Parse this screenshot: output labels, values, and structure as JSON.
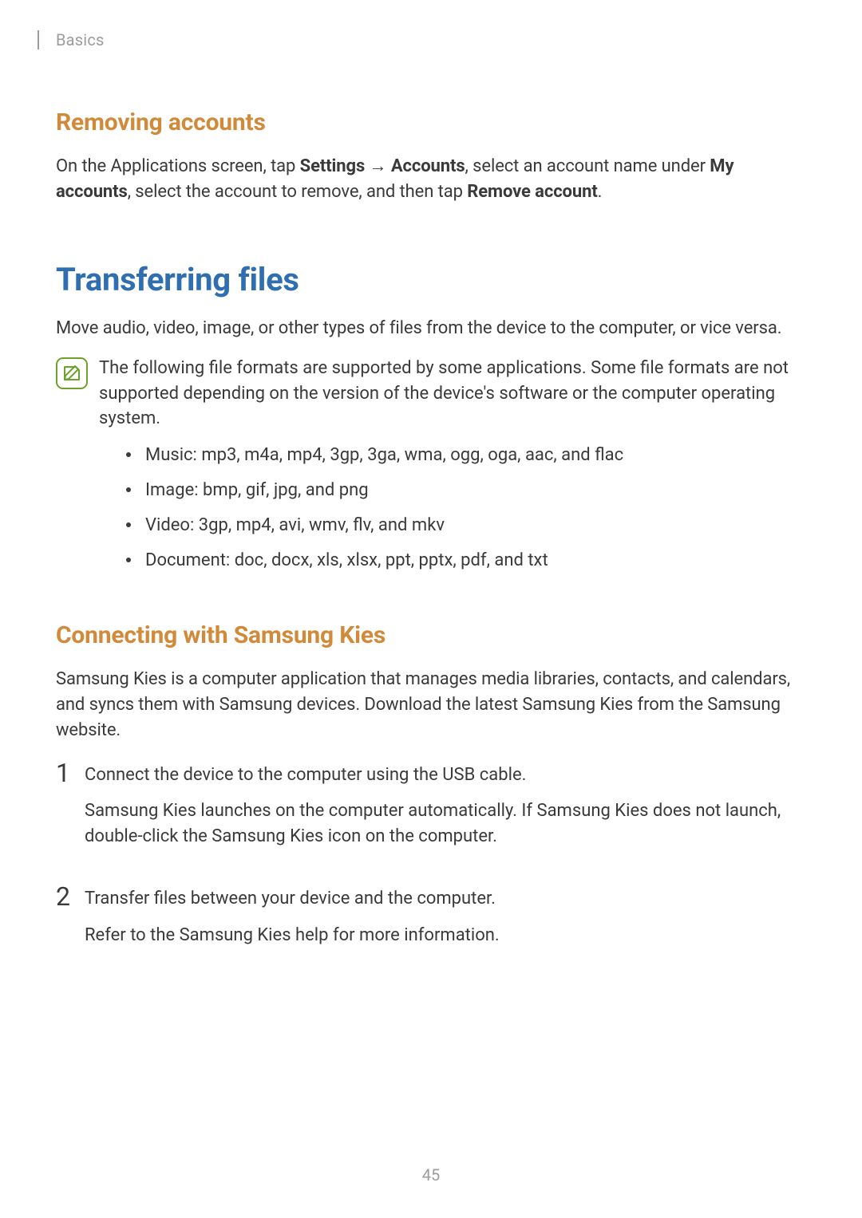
{
  "breadcrumb": "Basics",
  "section1": {
    "heading": "Removing accounts",
    "p_pre": "On the Applications screen, tap ",
    "settings": "Settings",
    "arrow": " → ",
    "accounts": "Accounts",
    "p_mid": ", select an account name under ",
    "myaccounts": "My accounts",
    "p_mid2": ", select the account to remove, and then tap ",
    "remove": "Remove account",
    "p_end": "."
  },
  "section2": {
    "heading": "Transferring files",
    "intro": "Move audio, video, image, or other types of files from the device to the computer, or vice versa.",
    "note": "The following file formats are supported by some applications. Some file formats are not supported depending on the version of the device's software or the computer operating system.",
    "bullets": [
      "Music: mp3, m4a, mp4, 3gp, 3ga, wma, ogg, oga, aac, and flac",
      "Image: bmp, gif, jpg, and png",
      "Video: 3gp, mp4, avi, wmv, flv, and mkv",
      "Document: doc, docx, xls, xlsx, ppt, pptx, pdf, and txt"
    ]
  },
  "section3": {
    "heading": "Connecting with Samsung Kies",
    "intro": "Samsung Kies is a computer application that manages media libraries, contacts, and calendars, and syncs them with Samsung devices. Download the latest Samsung Kies from the Samsung website.",
    "steps": [
      {
        "num": "1",
        "lines": [
          "Connect the device to the computer using the USB cable.",
          "Samsung Kies launches on the computer automatically. If Samsung Kies does not launch, double-click the Samsung Kies icon on the computer."
        ]
      },
      {
        "num": "2",
        "lines": [
          "Transfer files between your device and the computer.",
          "Refer to the Samsung Kies help for more information."
        ]
      }
    ]
  },
  "pageNumber": "45"
}
